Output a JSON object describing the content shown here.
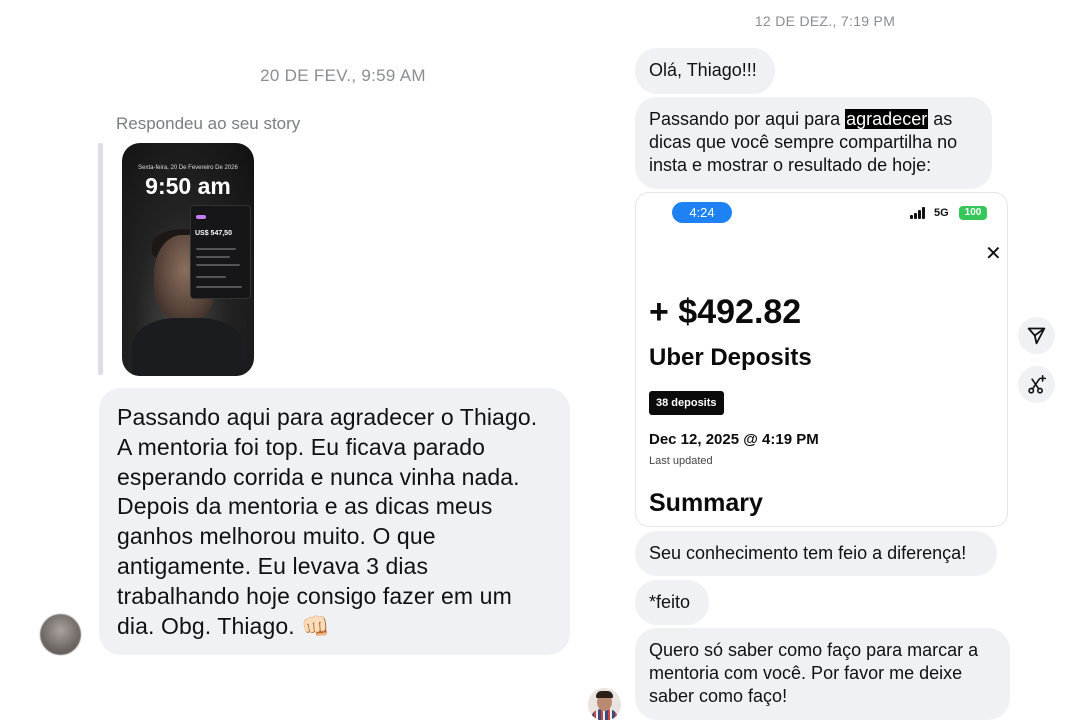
{
  "left_thread": {
    "timestamp": "20 DE FEV., 9:59 AM",
    "story_reply_label": "Respondeu ao seu story",
    "story_thumbnail": {
      "time": "9:50 am",
      "date_line": "Sexta-feira, 20 De Fevereiro De 2026",
      "amount": "US$ 547,50"
    },
    "message": "Passando aqui para agradecer o Thiago. A mentoria foi top. Eu ficava parado esperando corrida e nunca vinha nada. Depois da mentoria e as dicas meus ganhos melhorou muito. O que antigamente. Eu levava 3 dias trabalhando hoje consigo fazer em um dia. Obg. Thiago. 👊🏻"
  },
  "right_thread": {
    "timestamp": "12 DE DEZ., 7:19 PM",
    "msg_greeting": "Olá, Thiago!!!",
    "msg_thanks": {
      "before": "Passando por aqui para ",
      "highlight": "agradecer",
      "after": " as dicas que você sempre compartilha no insta e mostrar o resultado de hoje:"
    },
    "screenshot_card": {
      "status_time": "4:24",
      "network": "5G",
      "battery": "100",
      "amount": "+ $492.82",
      "title": "Uber Deposits",
      "badge": "38 deposits",
      "date": "Dec 12, 2025 @ 4:19 PM",
      "updated": "Last updated",
      "summary": "Summary"
    },
    "msg_knowledge": "Seu conhecimento tem feio a diferença!",
    "msg_correction": "*feito",
    "msg_question": "Quero só saber como faço para marcar a mentoria com você. Por favor me deixe saber como faço!"
  },
  "icons": {
    "close": "close-icon",
    "share": "send-icon",
    "magic": "ai-sparkle-icon"
  },
  "colors": {
    "bubble": "#eff1f4",
    "timestamp": "#8a8d91",
    "status_pill": "#1f82f4",
    "battery": "#35c759"
  }
}
